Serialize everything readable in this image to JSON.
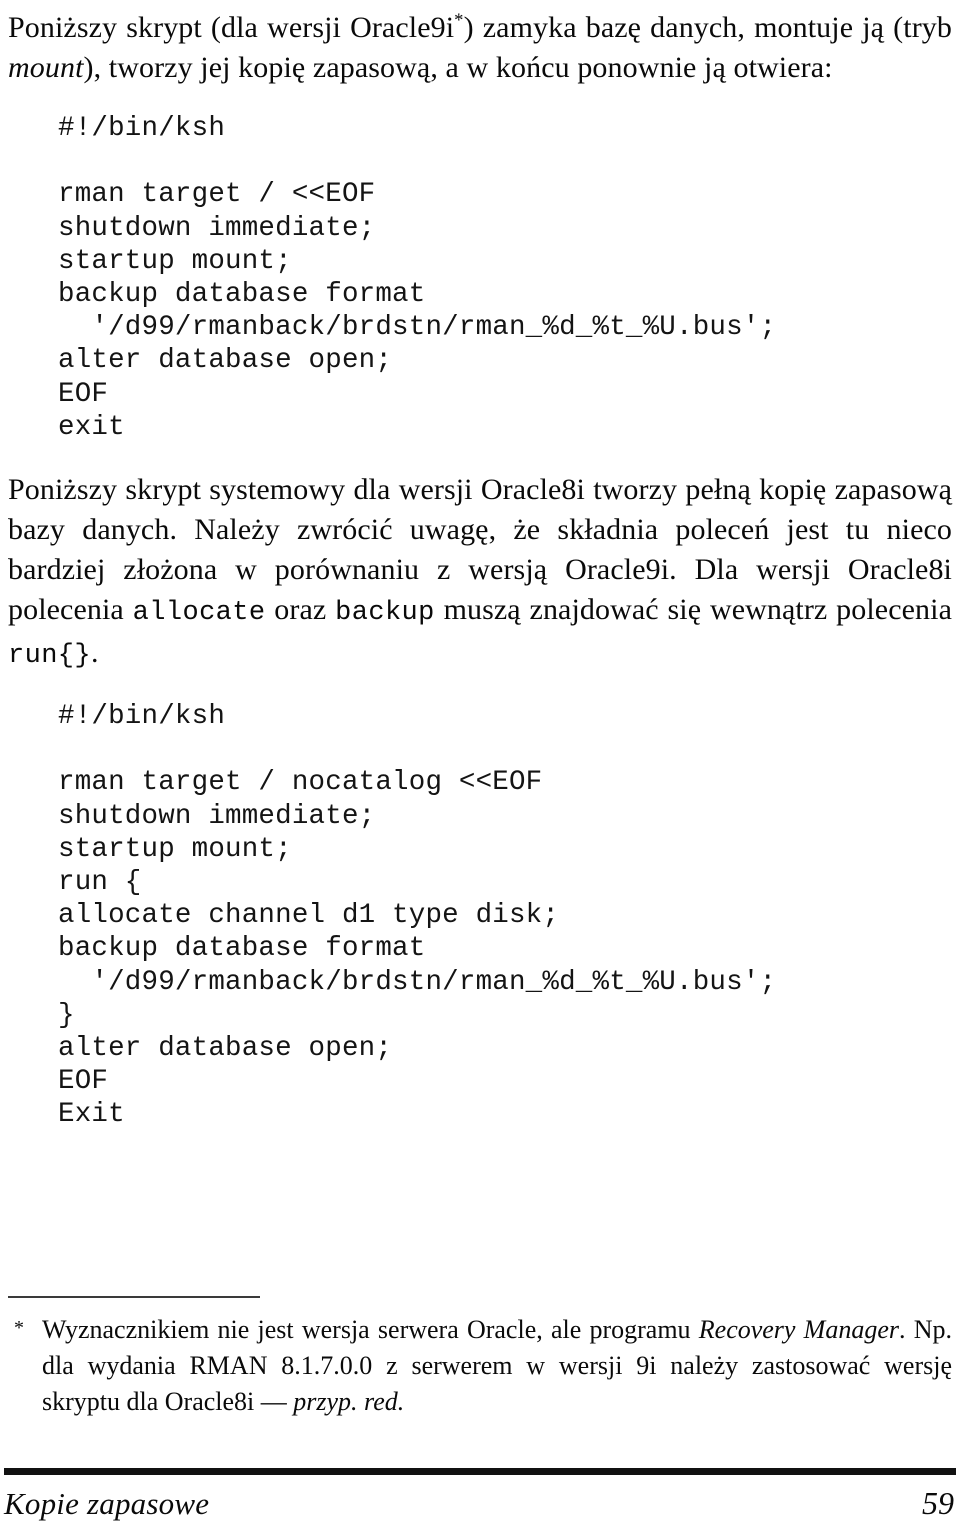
{
  "page": {
    "number": "59",
    "running_title": "Kopie zapasowe"
  },
  "intro_paragraph": {
    "before_link": "Poniższy skrypt (dla wersji Oracle9i",
    "footnote_marker": "*",
    "after_link": ") zamyka bazę danych, montuje ją (tryb ",
    "italic_term": "mount",
    "tail": "), tworzy jej kopię zapasową, a w końcu ponownie ją otwiera:"
  },
  "code_block_1": {
    "name": "oracle9i-rman-backup-script",
    "text": "#!/bin/ksh\n\nrman target / <<EOF\nshutdown immediate;\nstartup mount;\nbackup database format\n  '/d99/rmanback/brdstn/rman_%d_%t_%U.bus';\nalter database open;\nEOF\nexit"
  },
  "middle_paragraph": {
    "seg1": "Poniższy skrypt systemowy dla wersji Oracle8i tworzy pełną kopię zapasową bazy danych. Należy zwrócić uwagę, że składnia poleceń jest tu nieco bardziej złożona w porównaniu z wersją Oracle9i. Dla wersji Oracle8i polecenia ",
    "code1": "allocate",
    "seg2": " oraz ",
    "code2": "backup",
    "seg3": " muszą znajdować się wewnątrz polecenia ",
    "code3": "run{}",
    "seg4": "."
  },
  "code_block_2": {
    "name": "oracle8i-rman-backup-script",
    "text": "#!/bin/ksh\n\nrman target / nocatalog <<EOF\nshutdown immediate;\nstartup mount;\nrun {\nallocate channel d1 type disk;\nbackup database format\n  '/d99/rmanback/brdstn/rman_%d_%t_%U.bus';\n}\nalter database open;\nEOF\nExit"
  },
  "footnote": {
    "marker": "*",
    "seg1": "Wyznacznikiem nie jest wersja serwera Oracle, ale programu ",
    "italic1": "Recovery Manager",
    "seg2": ". Np. dla wydania RMAN 8.1.7.0.0 z serwerem w wersji 9i należy zastosować wersję skryptu dla Oracle8i — ",
    "italic2": "przyp. red."
  }
}
